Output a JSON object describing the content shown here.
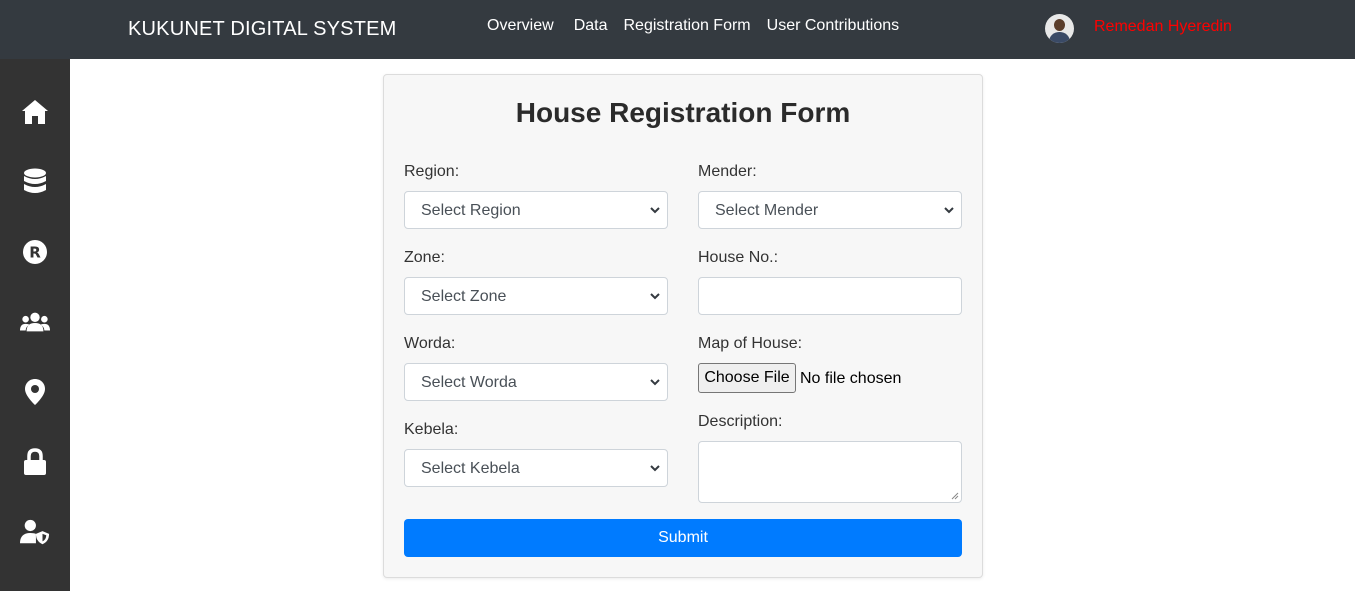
{
  "header": {
    "brand": "KUKUNET DIGITAL SYSTEM",
    "nav": [
      "Overview",
      "Data",
      "Registration Form",
      "User Contributions"
    ],
    "username": "Remedan Hyeredin"
  },
  "sidebar": {
    "items": [
      "home-icon",
      "database-icon",
      "registered-icon",
      "users-icon",
      "map-marker-icon",
      "lock-icon",
      "user-shield-icon"
    ]
  },
  "form": {
    "title": "House Registration Form",
    "region_label": "Region:",
    "region_value": "Select Region",
    "zone_label": "Zone:",
    "zone_value": "Select Zone",
    "worda_label": "Worda:",
    "worda_value": "Select Worda",
    "kebela_label": "Kebela:",
    "kebela_value": "Select Kebela",
    "mender_label": "Mender:",
    "mender_value": "Select Mender",
    "house_no_label": "House No.:",
    "house_no_value": "",
    "map_label": "Map of House:",
    "choose_file": "Choose File",
    "no_file": "No file chosen",
    "description_label": "Description:",
    "description_value": "",
    "submit": "Submit"
  },
  "colors": {
    "topbar": "#343a40",
    "sidebar": "#333333",
    "accent": "#007bff",
    "username": "#ff0000"
  }
}
